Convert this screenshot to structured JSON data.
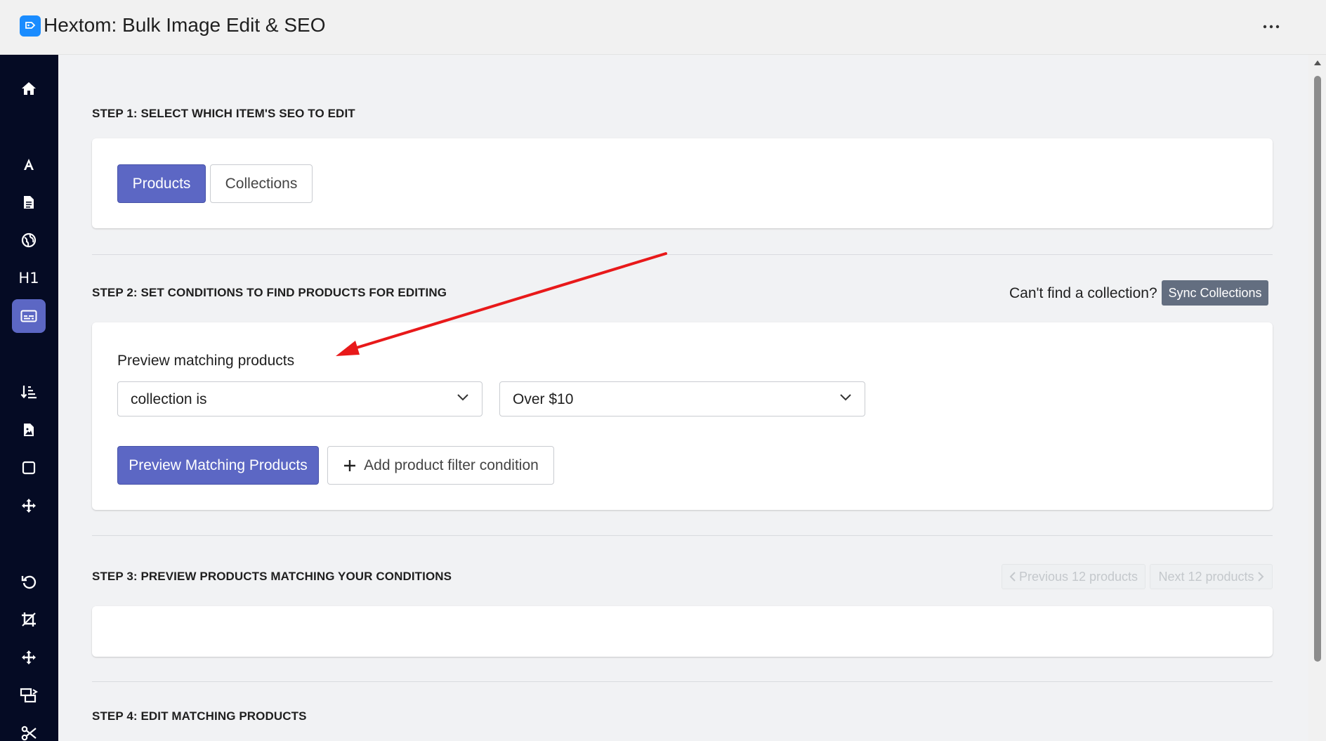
{
  "app": {
    "title": "Hextom: Bulk Image Edit & SEO"
  },
  "sidebar": {
    "items": [
      {
        "name": "home-icon"
      },
      {
        "name": "font-icon"
      },
      {
        "name": "file-icon"
      },
      {
        "name": "globe-icon"
      },
      {
        "name": "heading-icon",
        "label": "H1"
      },
      {
        "name": "caption-icon",
        "active": true
      },
      {
        "name": "sort-icon"
      },
      {
        "name": "image-file-icon"
      },
      {
        "name": "square-icon"
      },
      {
        "name": "move-icon"
      },
      {
        "name": "undo-icon"
      },
      {
        "name": "crop-icon"
      },
      {
        "name": "arrows-icon"
      },
      {
        "name": "resize-icon"
      },
      {
        "name": "scissors-icon"
      }
    ]
  },
  "step1": {
    "title": "STEP 1: SELECT WHICH ITEM'S SEO TO EDIT",
    "products_label": "Products",
    "collections_label": "Collections"
  },
  "step2": {
    "title": "STEP 2: SET CONDITIONS TO FIND PRODUCTS FOR EDITING",
    "cant_find": "Can't find a collection?",
    "sync_label": "Sync Collections",
    "preview_heading": "Preview matching products",
    "condition_select": "collection is",
    "value_select": "Over $10",
    "preview_button": "Preview Matching Products",
    "add_filter_button": "Add product filter condition"
  },
  "step3": {
    "title": "STEP 3: PREVIEW PRODUCTS MATCHING YOUR CONDITIONS",
    "prev_label": "Previous 12 products",
    "next_label": "Next 12 products"
  },
  "step4": {
    "title": "STEP 4: EDIT MATCHING PRODUCTS"
  },
  "colors": {
    "primary": "#5c67c4",
    "sidebar": "#050b24",
    "annotation": "#e8191a"
  }
}
